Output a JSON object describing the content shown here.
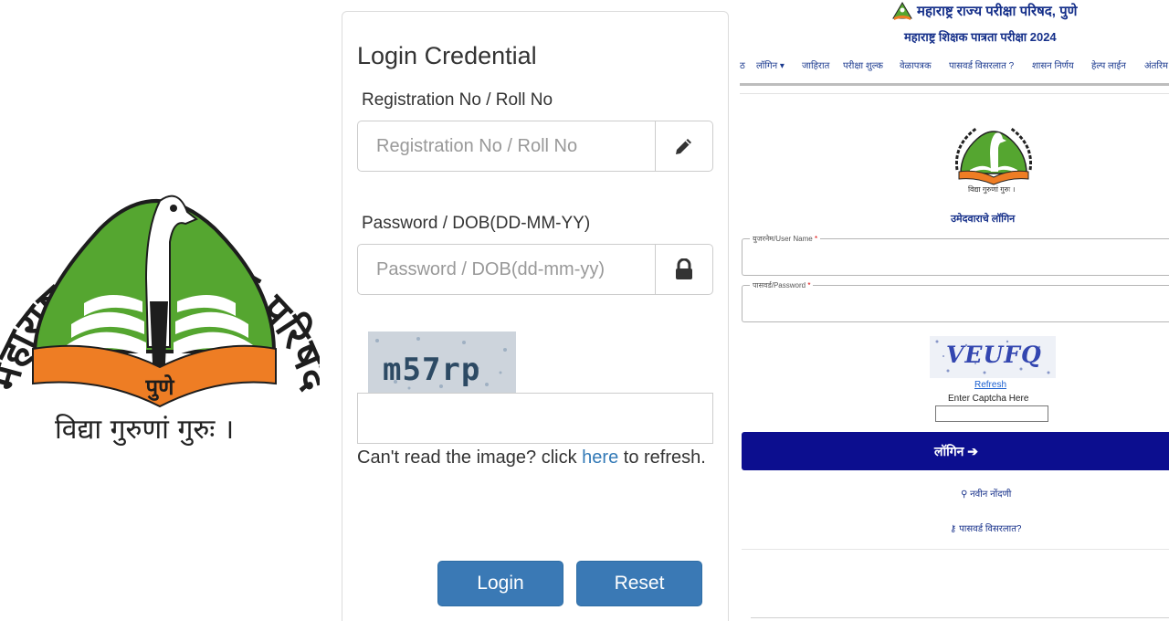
{
  "left_logo": {
    "arc_text": "महाराष्ट्र राज्य परीक्षा परिषद",
    "city": "पुणे",
    "motto": "विद्या गुरुणां गुरुः ।"
  },
  "login_panel": {
    "title": "Login Credential",
    "registration": {
      "label": "Registration No / Roll No",
      "placeholder": "Registration No / Roll No",
      "icon": "pencil-icon"
    },
    "password": {
      "label": "Password / DOB(DD-MM-YY)",
      "placeholder": "Password / DOB(dd-mm-yy)",
      "icon": "lock-icon"
    },
    "captcha_text": "m57rp",
    "captcha_value": "",
    "refresh_prefix": "Can't read the image? click ",
    "refresh_link": "here",
    "refresh_suffix": " to refresh.",
    "login_button": "Login",
    "reset_button": "Reset",
    "colors": {
      "button": "#3a79b5",
      "link": "#337ab7"
    }
  },
  "portal": {
    "header_title": "महाराष्ट्र राज्य परीक्षा परिषद, पुणे",
    "header_subtitle": "महाराष्ट्र शिक्षक पात्रता परीक्षा 2024",
    "nav": [
      "ठ",
      "लॉगिन ▾",
      "जाहिरात",
      "परीक्षा शुल्क",
      "वेळापत्रक",
      "पासवर्ड विसरलात ?",
      "शासन निर्णय",
      "हेल्प लाईन",
      "अंतरिम"
    ],
    "logo_motto": "विद्या गुरुणां गुरुः ।",
    "heading": "उमेदवाराचे लॉगिन",
    "username_legend": "युजरनेम/User Name",
    "password_legend": "पासवर्ड/Password",
    "required_mark": "*",
    "captcha_text": "VEUFQ",
    "refresh": "Refresh",
    "captcha_prompt": "Enter Captcha Here",
    "login_button": "लॉगिन ➔",
    "register_link": "⚲ नवीन नोंदणी",
    "forgot_link": "⚷ पासवर्ड विसरलात?",
    "colors": {
      "primary": "#0c0e8f",
      "text": "#16308a"
    }
  }
}
